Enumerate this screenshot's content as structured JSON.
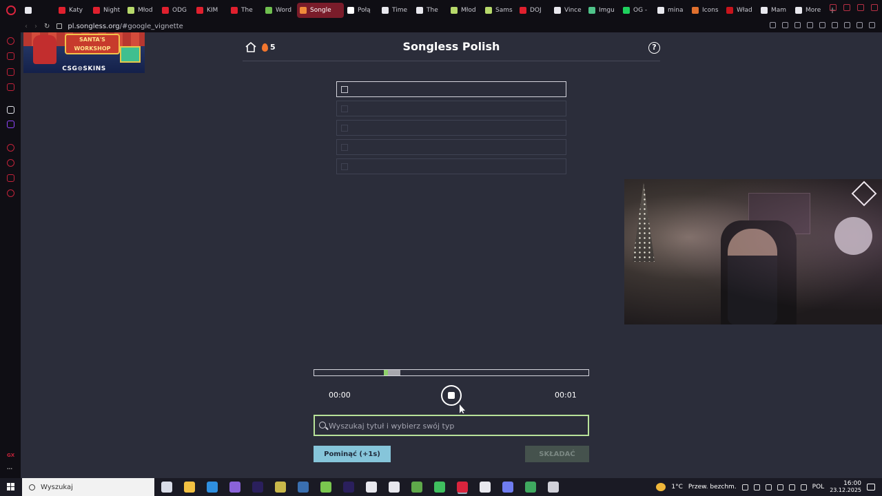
{
  "browser": {
    "tabs": [
      {
        "label": "Katy",
        "color": "#e0202e"
      },
      {
        "label": "Night",
        "color": "#e0202e"
      },
      {
        "label": "Młod",
        "color": "#b7d96b"
      },
      {
        "label": "ODG",
        "color": "#e0202e"
      },
      {
        "label": "KIM",
        "color": "#e0202e"
      },
      {
        "label": "The",
        "color": "#e0202e"
      },
      {
        "label": "Word",
        "color": "#6fbf4f"
      },
      {
        "label": "Songle",
        "color": "#f08a3a"
      },
      {
        "label": "Połą",
        "color": "#ffffff"
      },
      {
        "label": "Time",
        "color": "#e8e8ee"
      },
      {
        "label": "The",
        "color": "#e8e8ee"
      },
      {
        "label": "Młod",
        "color": "#b7d96b"
      },
      {
        "label": "Sams",
        "color": "#b7d96b"
      },
      {
        "label": "DOJ",
        "color": "#e0202e"
      },
      {
        "label": "Vince",
        "color": "#e8e8ee"
      },
      {
        "label": "Imgu",
        "color": "#4fc38a"
      },
      {
        "label": "OG -",
        "color": "#1fd15e"
      },
      {
        "label": "mina",
        "color": "#e8e8ee"
      },
      {
        "label": "Icons",
        "color": "#e0702e"
      },
      {
        "label": "Wład",
        "color": "#c8141c"
      },
      {
        "label": "Mam",
        "color": "#e8e8ee"
      },
      {
        "label": "More",
        "color": "#e8e8ee"
      }
    ],
    "active_tab_index": 7,
    "new_tab_label": "+",
    "url_host": "pl.songless.org",
    "url_path": "/#google_vignette",
    "nav_back": "‹",
    "nav_forward": "›",
    "nav_reload": "↻",
    "sidebar_label": "GX",
    "sidebar_more": "···"
  },
  "ad": {
    "sign_text": "SANTA'S WORKSHOP",
    "brand": "CSG⊙SKINS"
  },
  "header": {
    "title": "Songless Polish",
    "streak": "5",
    "help": "?"
  },
  "guesses": {
    "rows": [
      "",
      "",
      "",
      "",
      ""
    ],
    "current_index": 0
  },
  "player": {
    "start_time": "00:00",
    "end_time": "00:01",
    "played_fraction": 0.015,
    "buffered_fraction": 0.045
  },
  "search": {
    "placeholder": "Wyszukaj tytuł i wybierz swój typ",
    "value": ""
  },
  "actions": {
    "skip_label": "Pominąć (+1s)",
    "submit_label": "SKŁADAĆ"
  },
  "taskbar": {
    "search_label": "Wyszukaj",
    "apps": [
      {
        "name": "task-view",
        "color": "#d9dde8"
      },
      {
        "name": "file-explorer",
        "color": "#f2c142"
      },
      {
        "name": "vs-code",
        "color": "#2f8fe0"
      },
      {
        "name": "app-purple",
        "color": "#8a63d9"
      },
      {
        "name": "after-effects",
        "color": "#2a1f5c"
      },
      {
        "name": "app-money",
        "color": "#c9b84a"
      },
      {
        "name": "steam",
        "color": "#3a6fb0"
      },
      {
        "name": "notepad",
        "color": "#7ac74f"
      },
      {
        "name": "premiere",
        "color": "#2a1f5c"
      },
      {
        "name": "settings",
        "color": "#e8e8ee"
      },
      {
        "name": "obs",
        "color": "#e8e8ee"
      },
      {
        "name": "minecraft",
        "color": "#5fa84a"
      },
      {
        "name": "app-green",
        "color": "#3fbf5f"
      },
      {
        "name": "opera-gx",
        "color": "#d9243d"
      },
      {
        "name": "app-clock",
        "color": "#e8e8ee"
      },
      {
        "name": "discord",
        "color": "#6f7cf0"
      },
      {
        "name": "chrome",
        "color": "#3fa85f"
      },
      {
        "name": "app-shield",
        "color": "#d0d0d8"
      }
    ],
    "active_app_index": 13,
    "weather_temp": "1°C",
    "weather_desc": "Przew. bezchm.",
    "language": "POL",
    "time": "16:00",
    "date": "23.12.2025"
  },
  "colors": {
    "accent": "#d9243d",
    "page_bg": "#2b2d3a",
    "search_border": "#b9e39a",
    "skip_bg": "#86c5da",
    "submit_bg": "#45524d",
    "played": "#8fd16b"
  }
}
